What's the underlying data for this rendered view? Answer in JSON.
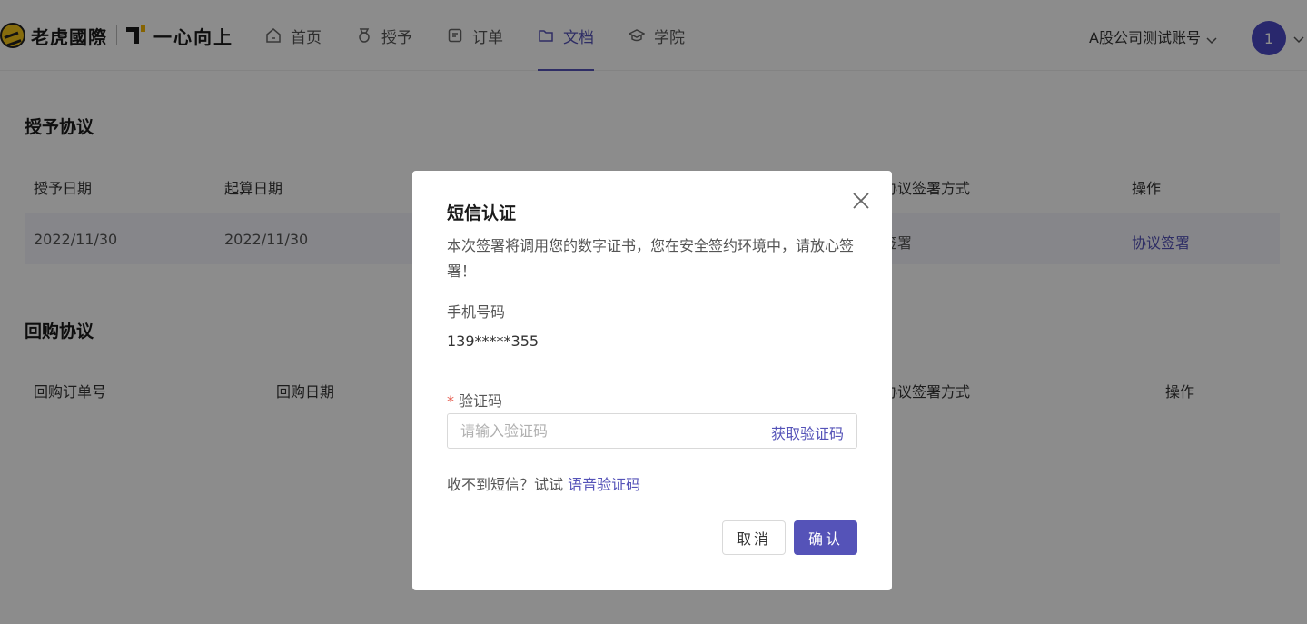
{
  "header": {
    "brand": "老虎國際",
    "slogan": "一心向上",
    "nav": [
      {
        "label": "首页",
        "icon": "home-icon",
        "active": false
      },
      {
        "label": "授予",
        "icon": "medal-icon",
        "active": false
      },
      {
        "label": "订单",
        "icon": "order-icon",
        "active": false
      },
      {
        "label": "文档",
        "icon": "folder-icon",
        "active": true
      },
      {
        "label": "学院",
        "icon": "graduation-cap-icon",
        "active": false
      }
    ],
    "account_name": "A股公司测试账号",
    "avatar_text": "1"
  },
  "grant_section": {
    "title": "授予协议",
    "columns": [
      "授予日期",
      "起算日期",
      "协议签署方式",
      "操作"
    ],
    "row": {
      "grant_date": "2022/11/30",
      "start_date": "2022/11/30",
      "sign_method": "签署",
      "action": "协议签署"
    }
  },
  "buyback_section": {
    "title": "回购协议",
    "columns": [
      "回购订单号",
      "回购日期",
      "协议签署方式",
      "操作"
    ]
  },
  "modal": {
    "title": "短信认证",
    "description": "本次签署将调用您的数字证书，您在安全签约环境中，请放心签署！",
    "phone_label": "手机号码",
    "phone_value": "139*****355",
    "code_required_mark": "*",
    "code_label": "验证码",
    "code_placeholder": "请输入验证码",
    "get_code_label": "获取验证码",
    "tip_prefix": "收不到短信？试试",
    "tip_link": "语音验证码",
    "cancel_label": "取消",
    "confirm_label": "确认"
  },
  "colors": {
    "accent": "#5553b8",
    "overlay": "rgba(0,0,0,0.45)",
    "required": "#e55b4d"
  }
}
